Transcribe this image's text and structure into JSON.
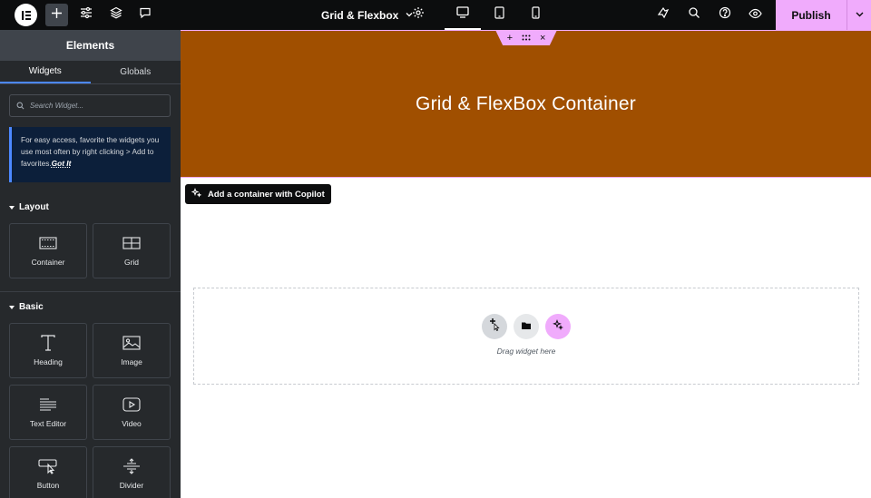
{
  "topbar": {
    "page_title": "Grid & Flexbox",
    "publish_label": "Publish",
    "icons": [
      "elementor-logo-icon",
      "add-icon",
      "settings-sliders-icon",
      "layers-icon",
      "comments-icon",
      "chevron-down-icon",
      "gear-icon",
      "desktop-icon",
      "tablet-icon",
      "mobile-icon",
      "notifications-icon",
      "search-icon",
      "help-icon",
      "preview-eye-icon",
      "chevron-down-icon"
    ]
  },
  "sidebar": {
    "title": "Elements",
    "tabs": [
      {
        "label": "Widgets",
        "active": true
      },
      {
        "label": "Globals",
        "active": false
      }
    ],
    "search_placeholder": "Search Widget...",
    "tip": {
      "text": "For easy access, favorite the widgets you use most often by right clicking > Add to favorites.",
      "action": "Got It"
    },
    "sections": [
      {
        "label": "Layout",
        "widgets": [
          {
            "label": "Container",
            "icon": "container-icon"
          },
          {
            "label": "Grid",
            "icon": "grid-icon"
          }
        ]
      },
      {
        "label": "Basic",
        "widgets": [
          {
            "label": "Heading",
            "icon": "heading-icon"
          },
          {
            "label": "Image",
            "icon": "image-icon"
          },
          {
            "label": "Text Editor",
            "icon": "text-editor-icon"
          },
          {
            "label": "Video",
            "icon": "video-icon"
          },
          {
            "label": "Button",
            "icon": "button-icon"
          },
          {
            "label": "Divider",
            "icon": "divider-icon"
          }
        ]
      }
    ]
  },
  "canvas": {
    "hero_heading": "Grid & FlexBox Container",
    "hero_bg": "#a04f00",
    "copilot_label": "Add a container with Copilot",
    "dropzone_text": "Drag widget here"
  },
  "colors": {
    "accent": "#f0abfc",
    "topbar": "#0c0d0e",
    "sidebar": "#26292c",
    "tab_underline": "#4c88ff"
  }
}
